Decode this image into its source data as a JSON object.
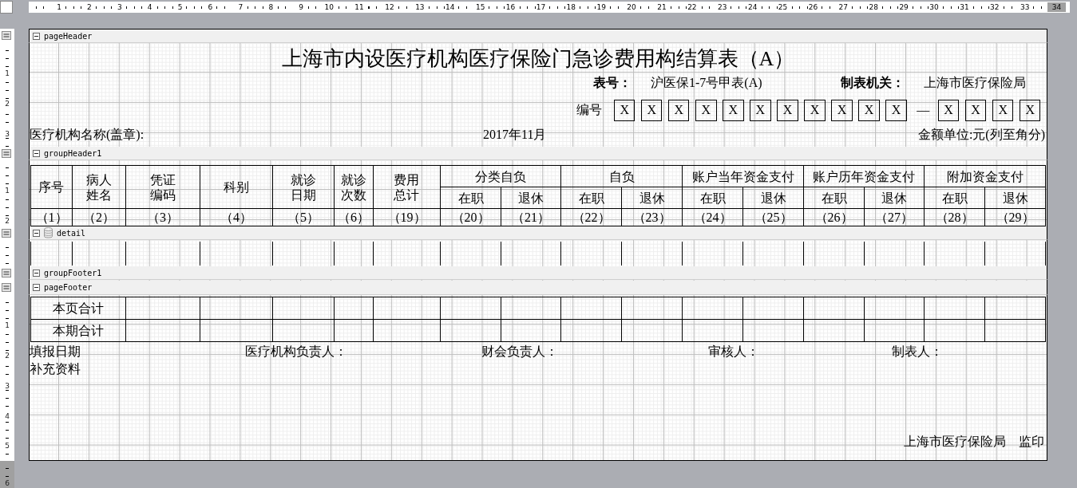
{
  "top_ruler": [
    {
      "label": "1",
      "selected": false
    },
    {
      "label": "2",
      "selected": false
    },
    {
      "label": "3",
      "selected": false
    },
    {
      "label": "4",
      "selected": false
    },
    {
      "label": "5",
      "selected": false
    },
    {
      "label": "6",
      "selected": false
    },
    {
      "label": "7",
      "selected": false
    },
    {
      "label": "8",
      "selected": false
    },
    {
      "label": "9",
      "selected": false
    },
    {
      "label": "10",
      "selected": false
    },
    {
      "label": "11",
      "selected": false
    },
    {
      "label": "12",
      "selected": false
    },
    {
      "label": "13",
      "selected": false
    },
    {
      "label": "14",
      "selected": false
    },
    {
      "label": "15",
      "selected": false
    },
    {
      "label": "16",
      "selected": false
    },
    {
      "label": "17",
      "selected": false
    },
    {
      "label": "18",
      "selected": false
    },
    {
      "label": "19",
      "selected": false
    },
    {
      "label": "20",
      "selected": false
    },
    {
      "label": "21",
      "selected": false
    },
    {
      "label": "22",
      "selected": false
    },
    {
      "label": "23",
      "selected": false
    },
    {
      "label": "24",
      "selected": false
    },
    {
      "label": "25",
      "selected": false
    },
    {
      "label": "26",
      "selected": false
    },
    {
      "label": "27",
      "selected": false
    },
    {
      "label": "28",
      "selected": false
    },
    {
      "label": "29",
      "selected": false
    },
    {
      "label": "30",
      "selected": false
    },
    {
      "label": "31",
      "selected": false
    },
    {
      "label": "32",
      "selected": false
    },
    {
      "label": "33",
      "selected": false
    },
    {
      "label": "34",
      "selected": true
    }
  ],
  "bands": [
    {
      "kind": "page_header",
      "title": "pageHeader",
      "expanded": true,
      "ruler": [
        "1",
        "2",
        "3"
      ]
    },
    {
      "kind": "group_header",
      "title": "groupHeader1",
      "expanded": true,
      "ruler": [
        "1",
        "2"
      ]
    },
    {
      "kind": "detail",
      "title": "detail",
      "expanded": true
    },
    {
      "kind": "group_footer",
      "title": "groupFooter1",
      "expanded": true
    },
    {
      "kind": "page_footer",
      "title": "pageFooter",
      "expanded": true,
      "ruler": [
        "1",
        "2",
        "3",
        "4",
        "5"
      ]
    }
  ],
  "left_ruler_end": {
    "label": "6",
    "selected": true
  },
  "page_header": {
    "title": "上海市内设医疗机构医疗保险门急诊费用构结算表（A）",
    "form_no_label": "表号：",
    "form_no": "沪医保1-7号甲表(A)",
    "issuer_label": "制表机关：",
    "issuer": "上海市医疗保险局",
    "serial_label": "编号",
    "serial_boxes_1": [
      "X",
      "X",
      "X",
      "X",
      "X",
      "X",
      "X",
      "X",
      "X",
      "X",
      "X"
    ],
    "serial_dash": "—",
    "serial_boxes_2": [
      "X",
      "X",
      "X",
      "X"
    ],
    "org_label": "医疗机构名称(盖章):",
    "period": "2017年11月",
    "unit": "金额单位:元(列至角分)"
  },
  "table": {
    "columns": [
      {
        "title": "序号",
        "number": "（1）"
      },
      {
        "title": "病人姓名",
        "number": "（2）"
      },
      {
        "title": "凭证编码",
        "number": "（3）"
      },
      {
        "title": "科别",
        "number": "（4）"
      },
      {
        "title": "就诊日期",
        "number": "（5）"
      },
      {
        "title": "就诊次数",
        "number": "（6）"
      },
      {
        "title": "费用总计",
        "number": "（19）"
      }
    ],
    "groups": [
      {
        "title": "分类自负",
        "columns": [
          {
            "title": "在职",
            "number": "（20）"
          },
          {
            "title": "退休",
            "number": "（21）"
          }
        ]
      },
      {
        "title": "自负",
        "columns": [
          {
            "title": "在职",
            "number": "（22）"
          },
          {
            "title": "退休",
            "number": "（23）"
          }
        ]
      },
      {
        "title": "账户当年资金支付",
        "columns": [
          {
            "title": "在职",
            "number": "（24）"
          },
          {
            "title": "退休",
            "number": "（25）"
          }
        ]
      },
      {
        "title": "账户历年资金支付",
        "columns": [
          {
            "title": "在职",
            "number": "（26）"
          },
          {
            "title": "退休",
            "number": "（27）"
          }
        ]
      },
      {
        "title": "附加资金支付",
        "columns": [
          {
            "title": "在职",
            "number": "（28）"
          },
          {
            "title": "退休",
            "number": "（29）"
          }
        ]
      }
    ]
  },
  "page_footer": {
    "rows": [
      "本页合计",
      "本期合计"
    ],
    "signatures": [
      "填报日期",
      "医疗机构负责人：",
      "财会负责人：",
      "审核人：",
      "制表人："
    ],
    "supplement": "补充资料",
    "seal": [
      "上海市医疗保险局",
      "监印"
    ]
  }
}
